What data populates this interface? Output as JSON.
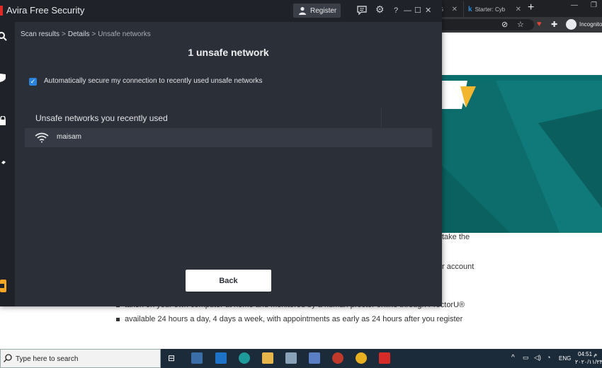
{
  "browser": {
    "tabs": [
      {
        "label": "G"
      },
      {
        "label": "Starter: Cyb"
      }
    ],
    "new_tab": "+",
    "min": "—",
    "restore": "❐",
    "incognito_label": "Incognito"
  },
  "web_page": {
    "lines": [
      "take the",
      "r account",
      "taken on your own computer at home and monitored by a human proctor online through ProctorU®",
      "available 24 hours a day, 4 days a week, with appointments as early as 24 hours after you register"
    ]
  },
  "avira": {
    "app_name": "Avira",
    "app_subtitle": "Free Security",
    "register_label": "Register",
    "help_label": "?",
    "breadcrumb": [
      "Scan results",
      "Details",
      "Unsafe networks"
    ],
    "breadcrumb_sep": ">",
    "page_title": "1 unsafe network",
    "auto_secure": {
      "checked": true,
      "label": "Automatically secure my connection to recently used unsafe networks"
    },
    "section_title": "Unsafe networks you recently used",
    "networks": [
      {
        "name": "maisam",
        "icon": "wifi-icon"
      }
    ],
    "back_label": "Back"
  },
  "taskbar": {
    "search_placeholder": "Type here to search",
    "language": "ENG",
    "time": "04:51 م",
    "date": "٢٠٢٠/١١/٢٣"
  },
  "colors": {
    "avira_bg": "#2b2f38",
    "avira_titlebar": "#1f2229",
    "accent_blue": "#2a82db",
    "teal": "#0c6d6c",
    "yellow": "#f2b52e"
  }
}
